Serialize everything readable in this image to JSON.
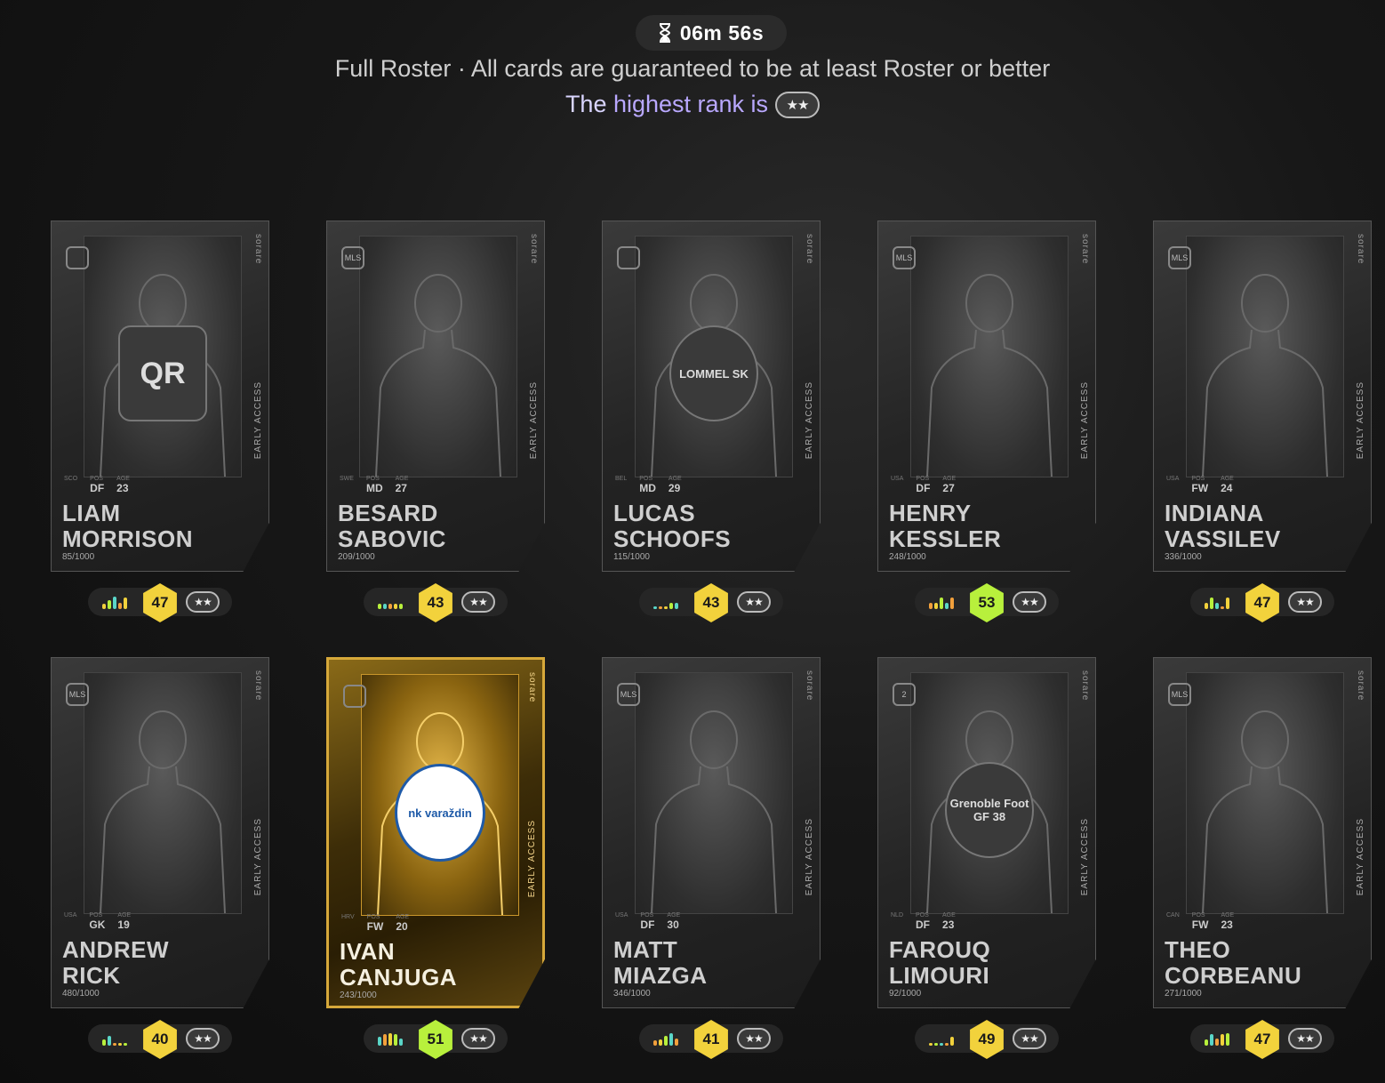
{
  "header": {
    "timer": "06m 56s",
    "subtitle": "Full Roster · All cards are guaranteed to be at least Roster or better",
    "rank_prefix": "The ",
    "rank_highlight": "highest rank is",
    "rank_stars": "★★"
  },
  "card_labels": {
    "pos": "POS",
    "age": "AGE",
    "brand": "sorare",
    "early_access": "EARLY ACCESS"
  },
  "colors": {
    "score_yellow": "#f2d23c",
    "score_green": "#b8f03c",
    "gold_border": "#d6a83a"
  },
  "cards": [
    {
      "first": "LIAM",
      "last": "MORRISON",
      "country": "SCO",
      "pos": "DF",
      "age": "23",
      "serial": "85/1000",
      "score": "47",
      "badge": "QR",
      "league": "circle-league-icon",
      "gold": false
    },
    {
      "first": "BESARD",
      "last": "SABOVIC",
      "country": "SWE",
      "pos": "MD",
      "age": "27",
      "serial": "209/1000",
      "score": "43",
      "badge": "",
      "league": "MLS",
      "gold": false
    },
    {
      "first": "LUCAS",
      "last": "SCHOOFS",
      "country": "BEL",
      "pos": "MD",
      "age": "29",
      "serial": "115/1000",
      "score": "43",
      "badge": "LOMMEL SK",
      "league": "lion-icon",
      "gold": false
    },
    {
      "first": "HENRY",
      "last": "KESSLER",
      "country": "USA",
      "pos": "DF",
      "age": "27",
      "serial": "248/1000",
      "score": "53",
      "badge": "",
      "league": "MLS",
      "gold": false
    },
    {
      "first": "INDIANA",
      "last": "VASSILEV",
      "country": "USA",
      "pos": "FW",
      "age": "24",
      "serial": "336/1000",
      "score": "47",
      "badge": "",
      "league": "MLS",
      "gold": false
    },
    {
      "first": "ANDREW",
      "last": "RICK",
      "country": "USA",
      "pos": "GK",
      "age": "19",
      "serial": "480/1000",
      "score": "40",
      "badge": "",
      "league": "MLS",
      "gold": false
    },
    {
      "first": "IVAN",
      "last": "CANJUGA",
      "country": "HRV",
      "pos": "FW",
      "age": "20",
      "serial": "243/1000",
      "score": "51",
      "badge": "nk varaždin",
      "league": "SuperSport HNL",
      "gold": true
    },
    {
      "first": "MATT",
      "last": "MIAZGA",
      "country": "USA",
      "pos": "DF",
      "age": "30",
      "serial": "346/1000",
      "score": "41",
      "badge": "",
      "league": "MLS",
      "gold": false
    },
    {
      "first": "FAROUQ",
      "last": "LIMOURI",
      "country": "NLD",
      "pos": "DF",
      "age": "23",
      "serial": "92/1000",
      "score": "49",
      "badge": "Grenoble Foot GF 38",
      "league": "2",
      "gold": false
    },
    {
      "first": "THEO",
      "last": "CORBEANU",
      "country": "CAN",
      "pos": "FW",
      "age": "23",
      "serial": "271/1000",
      "score": "47",
      "badge": "",
      "league": "MLS",
      "gold": false
    }
  ],
  "score_colors": [
    "yellow",
    "yellow",
    "yellow",
    "green",
    "yellow",
    "yellow",
    "green",
    "yellow",
    "yellow",
    "yellow"
  ],
  "form_bars": [
    [
      0.35,
      0.6,
      0.9,
      0.45,
      0.8
    ],
    [
      0.4,
      0.4,
      0.4,
      0.4,
      0.4
    ],
    [
      0.2,
      0.2,
      0.2,
      0.45,
      0.45
    ],
    [
      0.45,
      0.45,
      0.8,
      0.45,
      0.8
    ],
    [
      0.45,
      0.8,
      0.45,
      0.2,
      0.8
    ],
    [
      0.45,
      0.7,
      0.2,
      0.2,
      0.2
    ],
    [
      0.6,
      0.8,
      0.9,
      0.8,
      0.5
    ],
    [
      0.35,
      0.45,
      0.7,
      0.9,
      0.5
    ],
    [
      0.2,
      0.2,
      0.2,
      0.2,
      0.6
    ],
    [
      0.45,
      0.8,
      0.5,
      0.8,
      0.9
    ]
  ]
}
